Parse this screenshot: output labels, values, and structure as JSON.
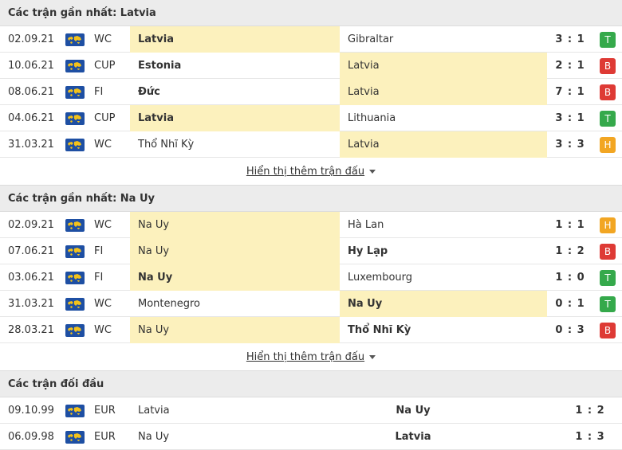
{
  "colors": {
    "win": "#35a94b",
    "loss": "#de3a35",
    "draw": "#f2a623",
    "highlight": "#fcf1bd"
  },
  "latvia": {
    "title": "Các trận gần nhất: Latvia",
    "more_label": "Hiển thị thêm trận đấu",
    "rows": [
      {
        "date": "02.09.21",
        "comp": "WC",
        "home": "Latvia",
        "away": "Gibraltar",
        "score": "3 : 1",
        "result": "T",
        "hl": "home",
        "bold": "home"
      },
      {
        "date": "10.06.21",
        "comp": "CUP",
        "home": "Estonia",
        "away": "Latvia",
        "score": "2 : 1",
        "result": "B",
        "hl": "away",
        "bold": "home"
      },
      {
        "date": "08.06.21",
        "comp": "FI",
        "home": "Đức",
        "away": "Latvia",
        "score": "7 : 1",
        "result": "B",
        "hl": "away",
        "bold": "home"
      },
      {
        "date": "04.06.21",
        "comp": "CUP",
        "home": "Latvia",
        "away": "Lithuania",
        "score": "3 : 1",
        "result": "T",
        "hl": "home",
        "bold": "home"
      },
      {
        "date": "31.03.21",
        "comp": "WC",
        "home": "Thổ Nhĩ Kỳ",
        "away": "Latvia",
        "score": "3 : 3",
        "result": "H",
        "hl": "away",
        "bold": ""
      }
    ]
  },
  "norway": {
    "title": "Các trận gần nhất: Na Uy",
    "more_label": "Hiển thị thêm trận đấu",
    "rows": [
      {
        "date": "02.09.21",
        "comp": "WC",
        "home": "Na Uy",
        "away": "Hà Lan",
        "score": "1 : 1",
        "result": "H",
        "hl": "home",
        "bold": ""
      },
      {
        "date": "07.06.21",
        "comp": "FI",
        "home": "Na Uy",
        "away": "Hy Lạp",
        "score": "1 : 2",
        "result": "B",
        "hl": "home",
        "bold": "away"
      },
      {
        "date": "03.06.21",
        "comp": "FI",
        "home": "Na Uy",
        "away": "Luxembourg",
        "score": "1 : 0",
        "result": "T",
        "hl": "home",
        "bold": "home"
      },
      {
        "date": "31.03.21",
        "comp": "WC",
        "home": "Montenegro",
        "away": "Na Uy",
        "score": "0 : 1",
        "result": "T",
        "hl": "away",
        "bold": "away"
      },
      {
        "date": "28.03.21",
        "comp": "WC",
        "home": "Na Uy",
        "away": "Thổ Nhĩ Kỳ",
        "score": "0 : 3",
        "result": "B",
        "hl": "home",
        "bold": "away"
      }
    ]
  },
  "h2h": {
    "title": "Các trận đối đầu",
    "rows": [
      {
        "date": "09.10.99",
        "comp": "EUR",
        "home": "Latvia",
        "away": "Na Uy",
        "score": "1 : 2"
      },
      {
        "date": "06.09.98",
        "comp": "EUR",
        "home": "Na Uy",
        "away": "Latvia",
        "score": "1 : 3"
      }
    ]
  }
}
